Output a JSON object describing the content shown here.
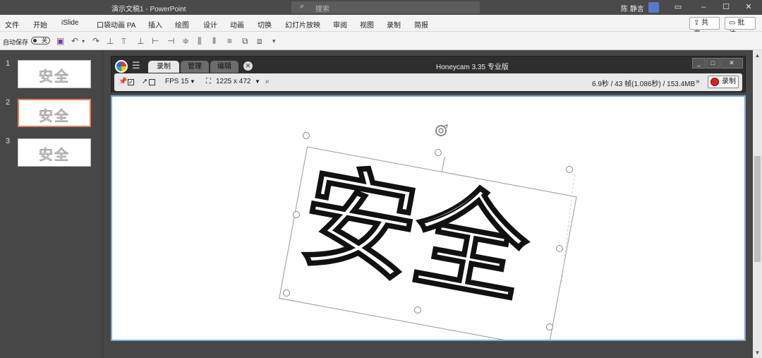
{
  "window": {
    "doc_title": "演示文稿1  -  PowerPoint",
    "search_placeholder": "搜索",
    "user_name": "陈 静言",
    "minimize": "–",
    "restore": "☐",
    "close": "✕"
  },
  "menu": {
    "items": [
      "文件",
      "开始",
      "iSlide",
      "口袋动画 PA",
      "插入",
      "绘图",
      "设计",
      "动画",
      "切换",
      "幻灯片放映",
      "审阅",
      "视图",
      "录制",
      "简报"
    ],
    "share": "共享",
    "comments": "批注"
  },
  "qat": {
    "autosave_label": "自动保存",
    "toggle_state": "关"
  },
  "thumbnails": [
    {
      "number": "1",
      "text": "安全",
      "active": false
    },
    {
      "number": "2",
      "text": "安全",
      "active": true
    },
    {
      "number": "3",
      "text": "安全",
      "active": false
    }
  ],
  "honeycam": {
    "tabs": [
      "录制",
      "管理",
      "编辑"
    ],
    "active_tab": "录制",
    "title": "Honeycam 3.35 专业版",
    "fps_label": "FPS 15",
    "size_label": "1225 x 472",
    "stats": "6.9秒 / 43 帧(1.086秒) / 153.4MB",
    "record_button": "录制"
  },
  "slide": {
    "text": "安全"
  },
  "colors": {
    "accent_thumb_border": "#d9836a",
    "slide_border": "#7aa9d6",
    "record_dot": "#dd2222"
  }
}
